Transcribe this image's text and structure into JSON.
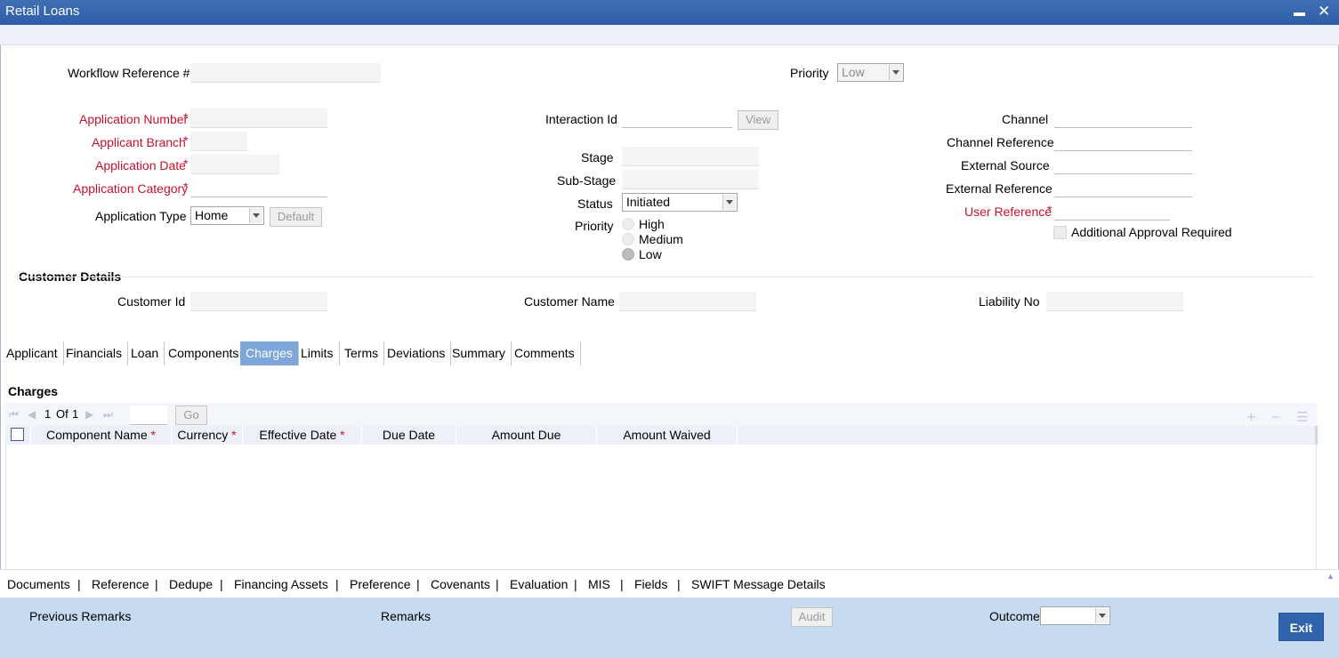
{
  "window": {
    "title": "Retail Loans",
    "minimize_glyph": "▬",
    "close_glyph": "✕"
  },
  "header": {
    "workflow_reference_label": "Workflow Reference #",
    "priority_label": "Priority",
    "priority_value": "Low"
  },
  "application": {
    "number_label": "Application Number",
    "branch_label": "Applicant Branch",
    "date_label": "Application Date",
    "category_label": "Application Category",
    "type_label": "Application Type",
    "type_value": "Home",
    "default_button": "Default",
    "required_mark": "*"
  },
  "interaction": {
    "interaction_id_label": "Interaction Id",
    "view_button": "View",
    "stage_label": "Stage",
    "substage_label": "Sub-Stage",
    "status_label": "Status",
    "status_value": "Initiated",
    "priority_label": "Priority",
    "priority_options": [
      "High",
      "Medium",
      "Low"
    ],
    "priority_selected": "Low"
  },
  "channel": {
    "channel_label": "Channel",
    "channel_reference_label": "Channel Reference",
    "external_source_label": "External Source",
    "external_reference_label": "External Reference",
    "user_reference_label": "User Reference",
    "additional_approval_label": "Additional Approval Required"
  },
  "customer": {
    "section_title": "Customer Details",
    "customer_id_label": "Customer Id",
    "customer_name_label": "Customer Name",
    "liability_no_label": "Liability No"
  },
  "tabs": [
    "Applicant",
    "Financials",
    "Loan",
    "Components",
    "Charges",
    "Limits",
    "Terms",
    "Deviations",
    "Summary",
    "Comments"
  ],
  "active_tab": "Charges",
  "charges": {
    "section_title": "Charges",
    "page_current": "1",
    "page_of": "Of",
    "page_total": "1",
    "go_button": "Go",
    "columns": [
      {
        "label": "Component Name",
        "required": true
      },
      {
        "label": "Currency",
        "required": true
      },
      {
        "label": "Effective Date",
        "required": true
      },
      {
        "label": "Due Date",
        "required": false
      },
      {
        "label": "Amount Due",
        "required": false
      },
      {
        "label": "Amount Waived",
        "required": false
      }
    ]
  },
  "bottom_links": [
    "Documents",
    "Reference",
    "Dedupe",
    "Financing Assets",
    "Preference",
    "Covenants",
    "Evaluation",
    "MIS",
    "Fields",
    "SWIFT Message Details"
  ],
  "link_separator": "|",
  "footer": {
    "previous_remarks_label": "Previous Remarks",
    "remarks_label": "Remarks",
    "audit_button": "Audit",
    "outcome_label": "Outcome",
    "exit_button": "Exit"
  }
}
